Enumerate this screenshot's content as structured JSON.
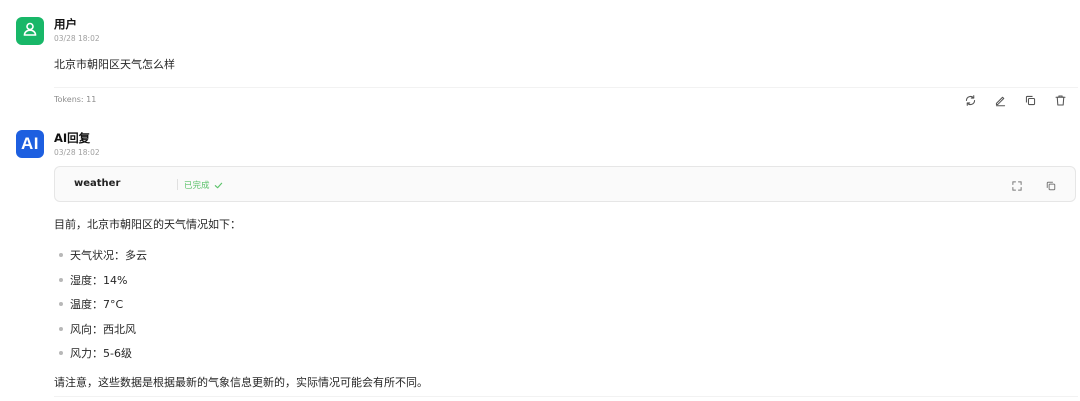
{
  "user_message": {
    "sender": "用户",
    "timestamp": "03/28 18:02",
    "text": "北京市朝阳区天气怎么样",
    "tokens": "Tokens: 11"
  },
  "ai_message": {
    "avatar_label": "AI",
    "sender": "AI回复",
    "timestamp": "03/28 18:02",
    "tool_call": {
      "name": "weather",
      "status": "已完成"
    },
    "intro": "目前，北京市朝阳区的天气情况如下：",
    "items": [
      "天气状况：多云",
      "湿度：14%",
      "温度：7°C",
      "风向：西北风",
      "风力：5-6级"
    ],
    "note": "请注意，这些数据是根据最新的气象信息更新的，实际情况可能会有所不同。"
  },
  "colors": {
    "user_avatar": "#18b768",
    "ai_avatar": "#1d5fe0",
    "status_green": "#5cc36b"
  },
  "icons": {
    "actions": [
      "refresh-icon",
      "edit-icon",
      "copy-icon",
      "delete-icon"
    ],
    "tool_actions": [
      "expand-icon",
      "copy-icon"
    ]
  }
}
